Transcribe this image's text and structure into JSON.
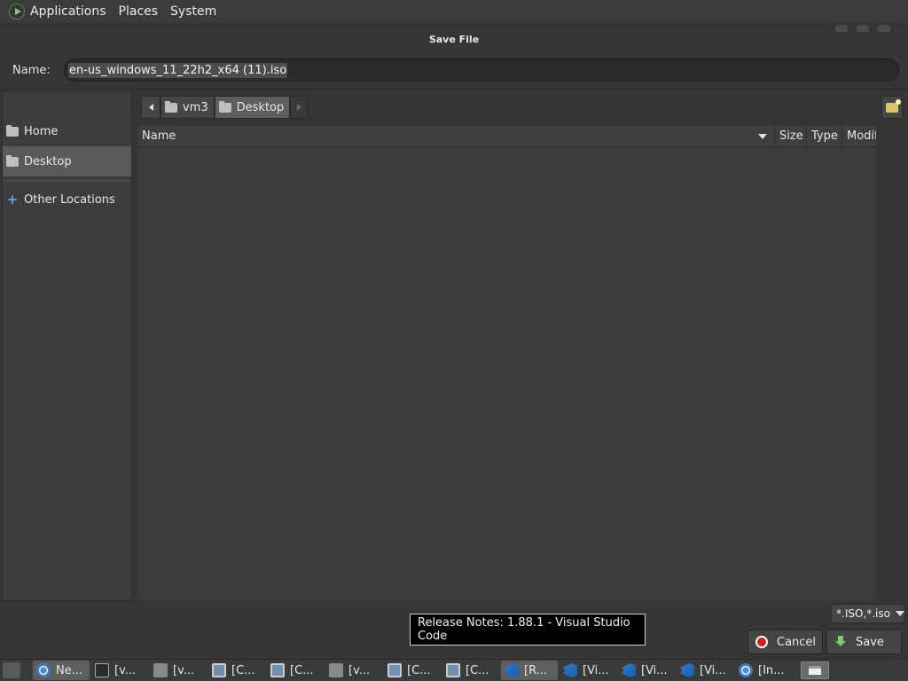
{
  "top_panel": {
    "menus": [
      "Applications",
      "Places",
      "System"
    ]
  },
  "dialog": {
    "title": "Save File",
    "name_label": "Name:",
    "filename": "en-us_windows_11_22h2_x64 (11).iso"
  },
  "sidebar": {
    "items": [
      {
        "label": "Home",
        "icon": "home-folder-icon"
      },
      {
        "label": "Desktop",
        "icon": "desktop-folder-icon",
        "active": true
      },
      {
        "label": "Other Locations",
        "icon": "plus-icon"
      }
    ]
  },
  "pathbar": {
    "segments": [
      "vm3",
      "Desktop"
    ]
  },
  "file_list": {
    "columns": [
      "Name",
      "Size",
      "Type",
      "Modif"
    ],
    "rows": []
  },
  "filter": {
    "selected": "*.ISO,*.iso"
  },
  "tooltip": {
    "text": "Release Notes: 1.88.1 - Visual Studio Code"
  },
  "buttons": {
    "cancel": "Cancel",
    "save": "Save"
  },
  "taskbar": {
    "tasks": [
      {
        "label": "Ne...",
        "icon": "chrome-icon",
        "active": true
      },
      {
        "label": "[v...",
        "icon": "terminal-icon"
      },
      {
        "label": "[v...",
        "icon": "folder-icon"
      },
      {
        "label": "[C...",
        "icon": "monitor-icon"
      },
      {
        "label": "[C...",
        "icon": "monitor-icon"
      },
      {
        "label": "[v...",
        "icon": "folder-icon"
      },
      {
        "label": "[C...",
        "icon": "monitor-icon"
      },
      {
        "label": "[C...",
        "icon": "monitor-icon"
      },
      {
        "label": "[R...",
        "icon": "vscode-icon",
        "active": true
      },
      {
        "label": "[Vi...",
        "icon": "vscode-icon"
      },
      {
        "label": "[Vi...",
        "icon": "vscode-icon"
      },
      {
        "label": "[Vi...",
        "icon": "vscode-icon"
      },
      {
        "label": "[In...",
        "icon": "chrome-icon"
      }
    ]
  }
}
